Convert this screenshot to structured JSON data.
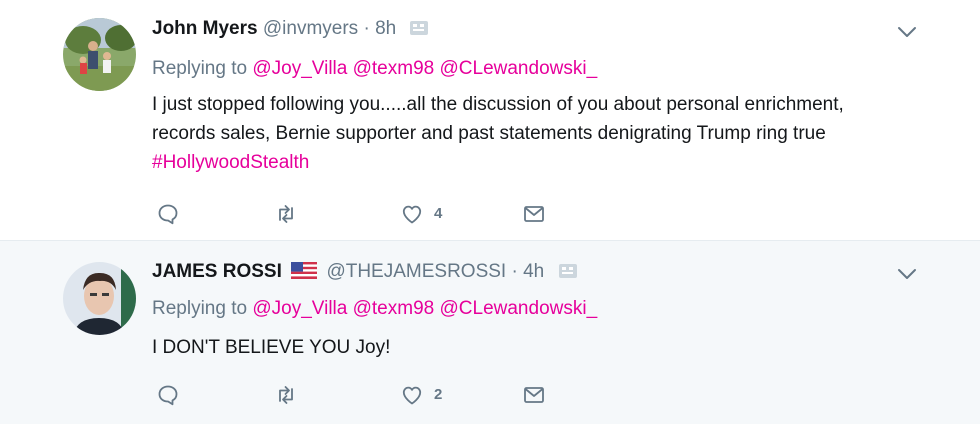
{
  "tweets": [
    {
      "author_name": "John Myers",
      "handle": "@invmyers",
      "separator": "·",
      "time": "8h",
      "reply_prefix": "Replying to",
      "reply_to": [
        "@Joy_Villa",
        "@texm98",
        "@CLewandowski_"
      ],
      "text_main": "I just stopped following you.....all the discussion of you about personal enrichment, records sales, Bernie supporter and past statements denigrating Trump ring true ",
      "hashtag": "#HollywoodStealth",
      "like_count": "4"
    },
    {
      "author_name": "JAMES ROSSI",
      "flag_icon": "us-flag-icon",
      "handle": "@THEJAMESROSSI",
      "separator": "·",
      "time": "4h",
      "reply_prefix": "Replying to",
      "reply_to": [
        "@Joy_Villa",
        "@texm98",
        "@CLewandowski_"
      ],
      "text_main": "I DON'T BELIEVE YOU Joy!",
      "like_count": "2"
    }
  ],
  "colors": {
    "mention": "#e6009b",
    "muted": "#657786",
    "highlight_bg": "#f5f8fa"
  }
}
